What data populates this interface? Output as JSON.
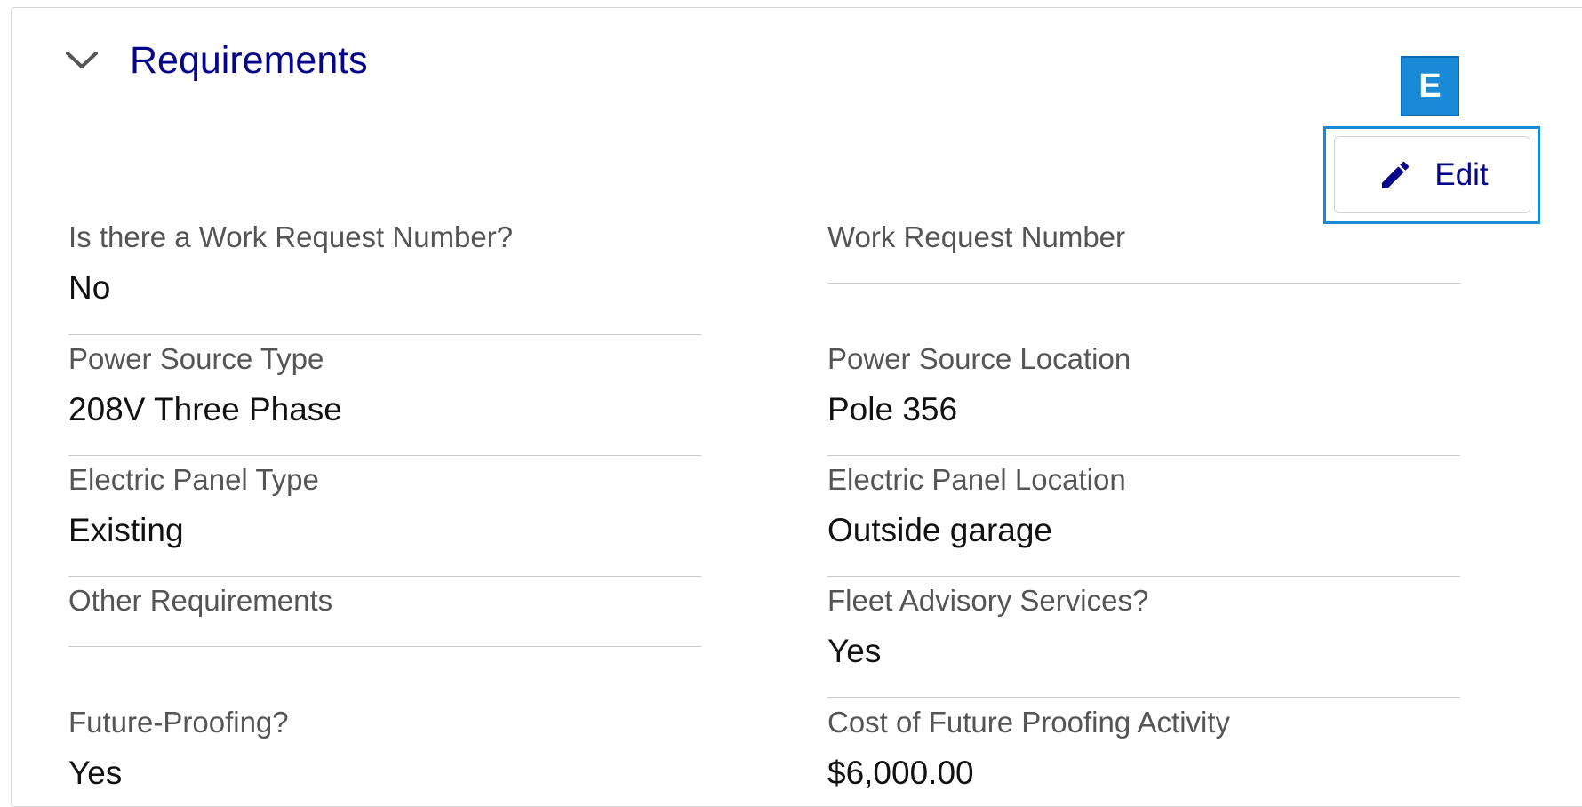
{
  "section": {
    "title": "Requirements",
    "chevron_icon": "chevron-down-icon"
  },
  "badge": {
    "label": "E",
    "color": "#1a8ad6"
  },
  "edit_button": {
    "label": "Edit",
    "icon": "pencil-icon"
  },
  "fields": {
    "work_request_q": {
      "label": "Is there a Work Request Number?",
      "value": "No"
    },
    "work_request_number": {
      "label": "Work Request Number",
      "value": ""
    },
    "power_source_type": {
      "label": "Power Source Type",
      "value": "208V Three Phase"
    },
    "power_source_location": {
      "label": "Power Source Location",
      "value": "Pole 356"
    },
    "electric_panel_type": {
      "label": "Electric Panel Type",
      "value": "Existing"
    },
    "electric_panel_location": {
      "label": "Electric Panel Location",
      "value": "Outside garage"
    },
    "other_requirements": {
      "label": "Other Requirements",
      "value": ""
    },
    "fleet_advisory": {
      "label": "Fleet Advisory Services?",
      "value": "Yes"
    },
    "future_proofing": {
      "label": "Future-Proofing?",
      "value": "Yes"
    },
    "future_proofing_cost": {
      "label": "Cost of Future Proofing Activity",
      "value": "$6,000.00"
    }
  },
  "colors": {
    "title": "#06068a",
    "label": "#555555",
    "value": "#111111",
    "divider": "#c9c9c9"
  }
}
